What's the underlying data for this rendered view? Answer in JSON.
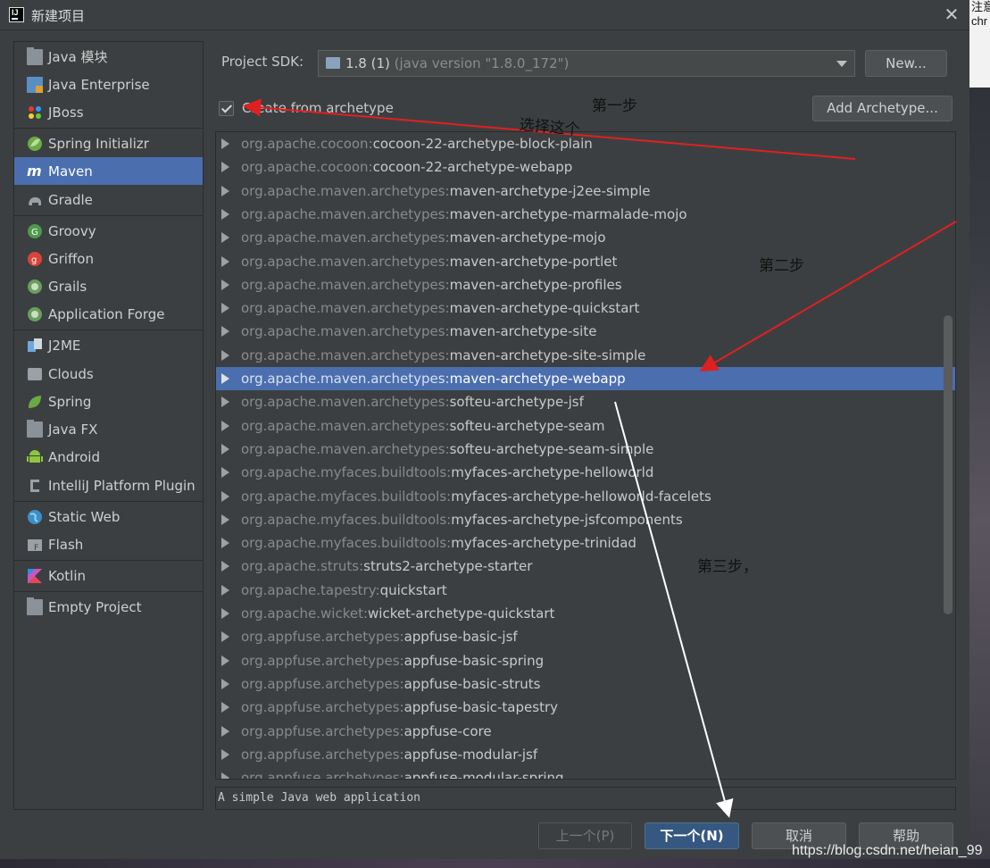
{
  "window": {
    "title": "新建项目"
  },
  "sidebar": {
    "items": [
      {
        "label": "Java 模块",
        "icon": "folder-module-icon"
      },
      {
        "label": "Java Enterprise",
        "icon": "java-enterprise-icon"
      },
      {
        "label": "JBoss",
        "icon": "jboss-icon"
      },
      {
        "label": "Spring Initializr",
        "icon": "spring-initializr-icon"
      },
      {
        "label": "Maven",
        "icon": "maven-icon",
        "selected": true
      },
      {
        "label": "Gradle",
        "icon": "gradle-icon"
      },
      {
        "label": "Groovy",
        "icon": "groovy-icon"
      },
      {
        "label": "Griffon",
        "icon": "griffon-icon"
      },
      {
        "label": "Grails",
        "icon": "grails-icon"
      },
      {
        "label": "Application Forge",
        "icon": "application-forge-icon"
      },
      {
        "label": "J2ME",
        "icon": "j2me-icon"
      },
      {
        "label": "Clouds",
        "icon": "clouds-icon"
      },
      {
        "label": "Spring",
        "icon": "spring-icon"
      },
      {
        "label": "Java FX",
        "icon": "javafx-icon"
      },
      {
        "label": "Android",
        "icon": "android-icon"
      },
      {
        "label": "IntelliJ Platform Plugin",
        "icon": "plugin-icon"
      },
      {
        "label": "Static Web",
        "icon": "static-web-icon"
      },
      {
        "label": "Flash",
        "icon": "flash-icon"
      },
      {
        "label": "Kotlin",
        "icon": "kotlin-icon"
      },
      {
        "label": "Empty Project",
        "icon": "empty-project-icon"
      }
    ]
  },
  "sdk": {
    "label": "Project SDK:",
    "value": "1.8 (1)",
    "hint": "(java version \"1.8.0_172\")",
    "new_button": "New..."
  },
  "archetype": {
    "checkbox_label": "Create from archetype",
    "checked": true,
    "add_button": "Add Archetype...",
    "description": "A simple Java web application"
  },
  "archetypes": [
    {
      "group": "org.apache.cocoon:",
      "artifact": "cocoon-22-archetype-block-plain"
    },
    {
      "group": "org.apache.cocoon:",
      "artifact": "cocoon-22-archetype-webapp"
    },
    {
      "group": "org.apache.maven.archetypes:",
      "artifact": "maven-archetype-j2ee-simple"
    },
    {
      "group": "org.apache.maven.archetypes:",
      "artifact": "maven-archetype-marmalade-mojo"
    },
    {
      "group": "org.apache.maven.archetypes:",
      "artifact": "maven-archetype-mojo"
    },
    {
      "group": "org.apache.maven.archetypes:",
      "artifact": "maven-archetype-portlet"
    },
    {
      "group": "org.apache.maven.archetypes:",
      "artifact": "maven-archetype-profiles"
    },
    {
      "group": "org.apache.maven.archetypes:",
      "artifact": "maven-archetype-quickstart"
    },
    {
      "group": "org.apache.maven.archetypes:",
      "artifact": "maven-archetype-site"
    },
    {
      "group": "org.apache.maven.archetypes:",
      "artifact": "maven-archetype-site-simple"
    },
    {
      "group": "org.apache.maven.archetypes:",
      "artifact": "maven-archetype-webapp",
      "selected": true
    },
    {
      "group": "org.apache.maven.archetypes:",
      "artifact": "softeu-archetype-jsf"
    },
    {
      "group": "org.apache.maven.archetypes:",
      "artifact": "softeu-archetype-seam"
    },
    {
      "group": "org.apache.maven.archetypes:",
      "artifact": "softeu-archetype-seam-simple"
    },
    {
      "group": "org.apache.myfaces.buildtools:",
      "artifact": "myfaces-archetype-helloworld"
    },
    {
      "group": "org.apache.myfaces.buildtools:",
      "artifact": "myfaces-archetype-helloworld-facelets"
    },
    {
      "group": "org.apache.myfaces.buildtools:",
      "artifact": "myfaces-archetype-jsfcomponents"
    },
    {
      "group": "org.apache.myfaces.buildtools:",
      "artifact": "myfaces-archetype-trinidad"
    },
    {
      "group": "org.apache.struts:",
      "artifact": "struts2-archetype-starter"
    },
    {
      "group": "org.apache.tapestry:",
      "artifact": "quickstart"
    },
    {
      "group": "org.apache.wicket:",
      "artifact": "wicket-archetype-quickstart"
    },
    {
      "group": "org.appfuse.archetypes:",
      "artifact": "appfuse-basic-jsf"
    },
    {
      "group": "org.appfuse.archetypes:",
      "artifact": "appfuse-basic-spring"
    },
    {
      "group": "org.appfuse.archetypes:",
      "artifact": "appfuse-basic-struts"
    },
    {
      "group": "org.appfuse.archetypes:",
      "artifact": "appfuse-basic-tapestry"
    },
    {
      "group": "org.appfuse.archetypes:",
      "artifact": "appfuse-core"
    },
    {
      "group": "org.appfuse.archetypes:",
      "artifact": "appfuse-modular-jsf"
    },
    {
      "group": "org.appfuse.archetypes:",
      "artifact": "appfuse-modular-spring"
    }
  ],
  "footer": {
    "prev": "上一个(P)",
    "next": "下一个(N)",
    "cancel": "取消",
    "help": "帮助"
  },
  "annotations": {
    "step1": "第一步",
    "step1_note": "选择这个",
    "step2": "第二步",
    "step3": "第三步，"
  },
  "background": {
    "top_right_text": "注意\nchr",
    "watermark": "https://blog.csdn.net/heian_99"
  },
  "colors": {
    "selection": "#4b6eaf",
    "primary_button": "#365880",
    "annotation_arrow_red": "#e02020",
    "annotation_arrow_white": "#ffffff"
  }
}
